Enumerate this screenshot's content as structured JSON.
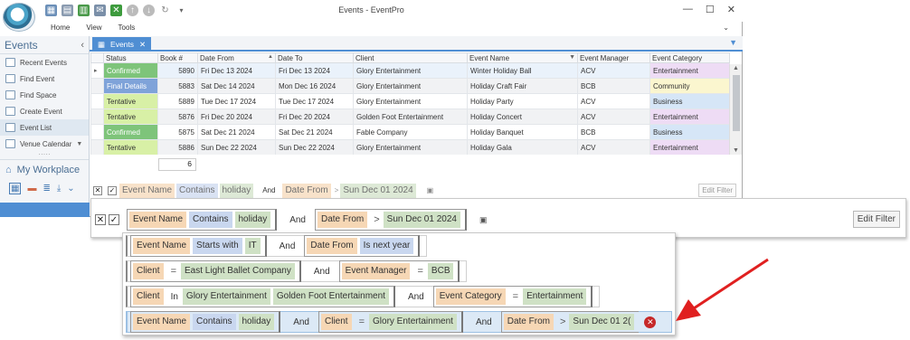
{
  "window": {
    "title": "Events - EventPro",
    "menu": [
      "Home",
      "View",
      "Tools"
    ],
    "minimize": "—",
    "maximize": "☐",
    "close": "✕"
  },
  "sidebar": {
    "title": "Events",
    "items": [
      {
        "label": "Recent Events"
      },
      {
        "label": "Find Event"
      },
      {
        "label": "Find Space"
      },
      {
        "label": "Create Event"
      },
      {
        "label": "Event List"
      },
      {
        "label": "Venue Calendar"
      }
    ],
    "workplace": "My Workplace"
  },
  "tab": {
    "label": "Events",
    "close": "✕"
  },
  "grid": {
    "columns": [
      "Status",
      "Book #",
      "Date From",
      "Date To",
      "Client",
      "Event Name",
      "Event Manager",
      "Event Category"
    ],
    "rows": [
      {
        "status": "Confirmed",
        "book": "5890",
        "from": "Fri Dec 13 2024",
        "to": "Fri Dec 13 2024",
        "client": "Glory Entertainment",
        "event": "Winter Holiday Ball",
        "manager": "ACV",
        "category": "Entertainment"
      },
      {
        "status": "Final Details",
        "book": "5883",
        "from": "Sat Dec 14 2024",
        "to": "Mon Dec 16 2024",
        "client": "Glory Entertainment",
        "event": "Holiday Craft Fair",
        "manager": "BCB",
        "category": "Community"
      },
      {
        "status": "Tentative",
        "book": "5889",
        "from": "Tue Dec 17 2024",
        "to": "Tue Dec 17 2024",
        "client": "Glory Entertainment",
        "event": "Holiday Party",
        "manager": "ACV",
        "category": "Business"
      },
      {
        "status": "Tentative",
        "book": "5876",
        "from": "Fri Dec 20 2024",
        "to": "Fri Dec 20 2024",
        "client": "Golden Foot Entertainment",
        "event": "Holiday Concert",
        "manager": "ACV",
        "category": "Entertainment"
      },
      {
        "status": "Confirmed",
        "book": "5875",
        "from": "Sat Dec 21 2024",
        "to": "Sat Dec 21 2024",
        "client": "Fable Company",
        "event": "Holiday Banquet",
        "manager": "BCB",
        "category": "Business"
      },
      {
        "status": "Tentative",
        "book": "5886",
        "from": "Sun Dec 22 2024",
        "to": "Sun Dec 22 2024",
        "client": "Glory Entertainment",
        "event": "Holiday Gala",
        "manager": "ACV",
        "category": "Entertainment"
      }
    ],
    "count": "6",
    "status_colors": {
      "Confirmed": "#7ec47a",
      "Final Details": "#7fa3d9",
      "Tentative": "#d8f0a6"
    },
    "category_colors": {
      "Entertainment": "#eedcf5",
      "Community": "#fbf6cf",
      "Business": "#d6e6f7"
    }
  },
  "filter": {
    "field": "Event Name",
    "op": "Contains",
    "value": "holiday",
    "and": "And",
    "field2": "Date From",
    "op2": ">",
    "value2": "Sun Dec 01 2024",
    "edit": "Edit Filter"
  },
  "mru": [
    {
      "f1": "Event Name",
      "o1": "Starts with",
      "v1": "IT",
      "f2": "Date From",
      "o2": "Is next year"
    },
    {
      "f1": "Client",
      "o1": "=",
      "v1": "East Light Ballet Company",
      "f2": "Event Manager",
      "o2": "=",
      "v2": "BCB"
    },
    {
      "f1": "Client",
      "o1": "In",
      "v1": "Glory Entertainment",
      "v1b": "Golden Foot Entertainment",
      "f2": "Event Category",
      "o2": "=",
      "v2": "Entertainment"
    },
    {
      "f1": "Event Name",
      "o1": "Contains",
      "v1": "holiday",
      "f2": "Client",
      "o2": "=",
      "v2": "Glory Entertainment",
      "f3": "Date From",
      "o3": ">",
      "v3": "Sun Dec 01 2("
    }
  ],
  "colors": {
    "accent": "#4f8ed3",
    "field": "#f6d7b5",
    "operator": "#c9d7ef",
    "value": "#cfe1c5",
    "arrow": "#e02020"
  }
}
